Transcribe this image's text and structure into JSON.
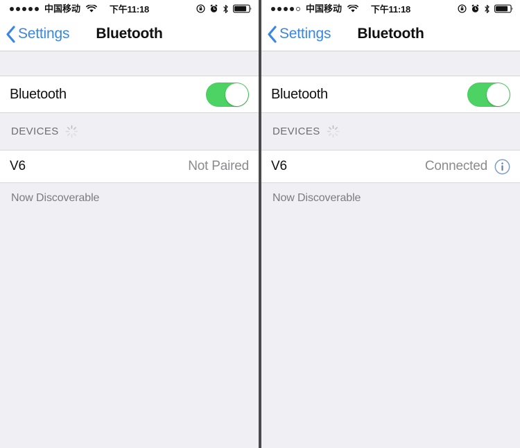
{
  "panels": [
    {
      "id": "left",
      "status_bar": {
        "signal_dots_filled": 5,
        "signal_dots_total": 5,
        "carrier": "中国移动",
        "wifi_icon": "wifi-icon",
        "time": "下午11:18",
        "right_icons": [
          "rotation-lock-icon",
          "alarm-clock-icon",
          "bluetooth-icon",
          "battery-icon"
        ]
      },
      "nav": {
        "back_icon": "chevron-left-icon",
        "back_label": "Settings",
        "title": "Bluetooth"
      },
      "bluetooth_row": {
        "label": "Bluetooth",
        "toggle_state": "on",
        "toggle_color": "#4dd363"
      },
      "devices_section": {
        "header": "DEVICES",
        "spinner_icon": "loading-spinner-icon",
        "rows": [
          {
            "name": "V6",
            "status": "Not Paired",
            "has_info_button": false
          }
        ]
      },
      "footer_note": "Now Discoverable"
    },
    {
      "id": "right",
      "status_bar": {
        "signal_dots_filled": 4,
        "signal_dots_total": 5,
        "carrier": "中国移动",
        "wifi_icon": "wifi-icon",
        "time": "下午11:18",
        "right_icons": [
          "rotation-lock-icon",
          "alarm-clock-icon",
          "bluetooth-icon",
          "battery-icon"
        ]
      },
      "nav": {
        "back_icon": "chevron-left-icon",
        "back_label": "Settings",
        "title": "Bluetooth"
      },
      "bluetooth_row": {
        "label": "Bluetooth",
        "toggle_state": "on",
        "toggle_color": "#4dd363"
      },
      "devices_section": {
        "header": "DEVICES",
        "spinner_icon": "loading-spinner-icon",
        "rows": [
          {
            "name": "V6",
            "status": "Connected",
            "has_info_button": true,
            "info_icon": "info-circle-icon"
          }
        ]
      },
      "footer_note": "Now Discoverable"
    }
  ],
  "colors": {
    "accent_blue": "#3a86e0",
    "toggle_green": "#4dd363",
    "background_gray": "#efeff4",
    "row_white": "#ffffff",
    "secondary_text": "#8a8a8f",
    "divider": "#4a4a4c"
  }
}
